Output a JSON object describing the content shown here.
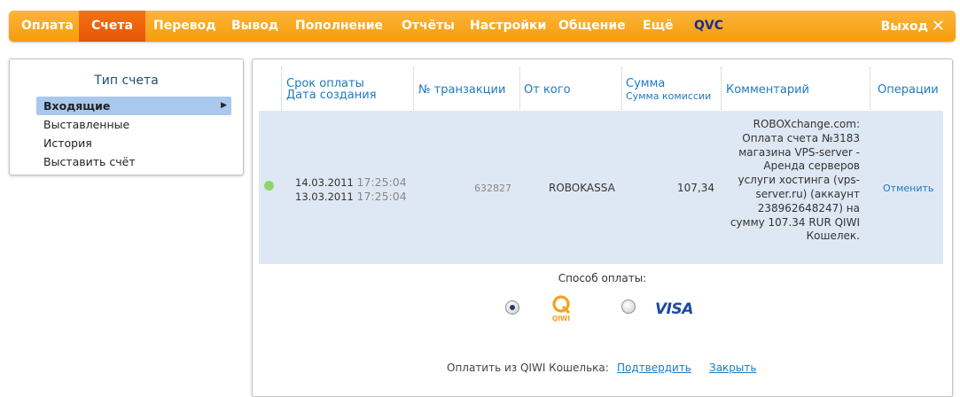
{
  "nav": {
    "items": [
      "Оплата",
      "Счета",
      "Перевод",
      "Вывод",
      "Пополнение",
      "Отчёты",
      "Настройки",
      "Общение",
      "Ещё",
      "QVC"
    ],
    "active": "Счета",
    "logout": "Выход",
    "logout_icon": "✕"
  },
  "sidebar": {
    "title": "Тип счета",
    "items": [
      "Входящие",
      "Выставленные",
      "История",
      "Выставить счёт"
    ],
    "selected": "Входящие",
    "arrow": "▶"
  },
  "table": {
    "headers": {
      "due_date": "Срок оплаты",
      "created": "Дата создания",
      "txn": "№ транзакции",
      "from": "От кого",
      "sum": "Сумма",
      "commission": "Сумма комиссии",
      "comment": "Комментарий",
      "ops": "Операции"
    },
    "row": {
      "due_date": "14.03.2011",
      "due_time": "17:25:04",
      "created_date": "13.03.2011",
      "created_time": "17:25:04",
      "txn": "632827",
      "from": "ROBOKASSA",
      "sum": "107,34",
      "comment": "ROBOXchange.com: Оплата счета №3183 магазина VPS-server - Аренда серверов услуги хостинга (vps-server.ru) (аккаунт 238962648247) на сумму 107.34 RUR QIWI Кошелек.",
      "action": "Отменить",
      "status_color": "#8fd46b"
    }
  },
  "payment": {
    "label": "Способ оплаты:",
    "methods": [
      "QIWI",
      "VISA"
    ],
    "selected": "QIWI",
    "footer_label": "Оплатить из QIWI Кошелька:",
    "confirm": "Подтвердить",
    "close": "Закрыть"
  },
  "colors": {
    "nav_bg": "#f7a41f",
    "nav_active": "#e85c0c",
    "link": "#1e7ac0",
    "row_bg": "#dee8f4",
    "selected_item": "#a9c8ee"
  }
}
